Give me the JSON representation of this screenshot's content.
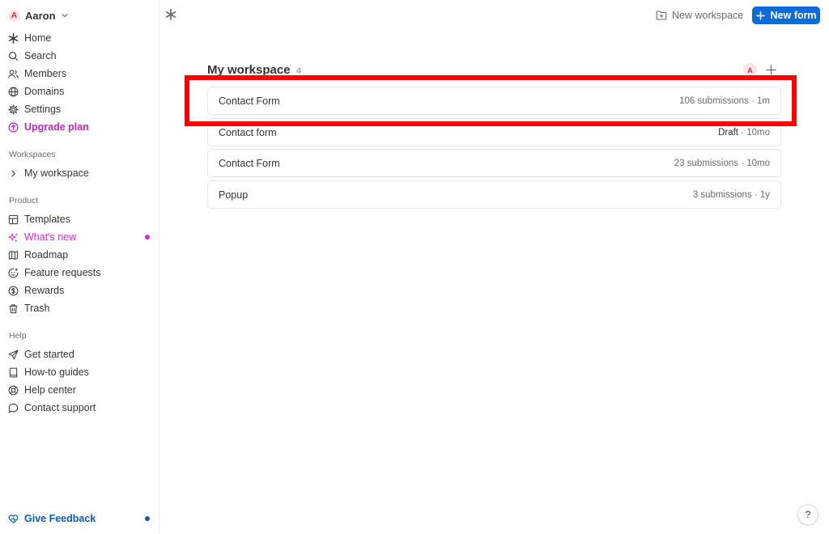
{
  "user": {
    "initial": "A",
    "name": "Aaron"
  },
  "nav_main": [
    {
      "label": "Home",
      "icon": "asterisk-icon"
    },
    {
      "label": "Search",
      "icon": "search-icon"
    },
    {
      "label": "Members",
      "icon": "members-icon"
    },
    {
      "label": "Domains",
      "icon": "globe-icon"
    },
    {
      "label": "Settings",
      "icon": "gear-icon"
    },
    {
      "label": "Upgrade plan",
      "icon": "upgrade-icon"
    }
  ],
  "sections": {
    "workspaces": "Workspaces",
    "product": "Product",
    "help": "Help"
  },
  "workspaces": [
    {
      "label": "My workspace"
    }
  ],
  "product": [
    {
      "label": "Templates"
    },
    {
      "label": "What's new"
    },
    {
      "label": "Roadmap"
    },
    {
      "label": "Feature requests"
    },
    {
      "label": "Rewards"
    },
    {
      "label": "Trash"
    }
  ],
  "help": [
    {
      "label": "Get started"
    },
    {
      "label": "How-to guides"
    },
    {
      "label": "Help center"
    },
    {
      "label": "Contact support"
    }
  ],
  "feedback": {
    "label": "Give Feedback"
  },
  "topbar": {
    "new_workspace": "New workspace",
    "new_form": "New form"
  },
  "workspace": {
    "title": "My workspace",
    "count": "4",
    "avatar_initial": "A",
    "forms": [
      {
        "name": "Contact Form",
        "status": "",
        "meta": "106 submissions · 1m"
      },
      {
        "name": "Contact form",
        "status": "Draft",
        "meta": " · 10mo"
      },
      {
        "name": "Contact Form",
        "status": "",
        "meta": "23 submissions · 10mo"
      },
      {
        "name": "Popup",
        "status": "",
        "meta": "3 submissions · 1y"
      }
    ]
  },
  "help_button": "?",
  "colors": {
    "accent": "#0f6bda",
    "upgrade": "#c026b9",
    "whats_new": "#e225d6",
    "feedback": "#0c5bb5",
    "highlight": "#ff0000"
  }
}
